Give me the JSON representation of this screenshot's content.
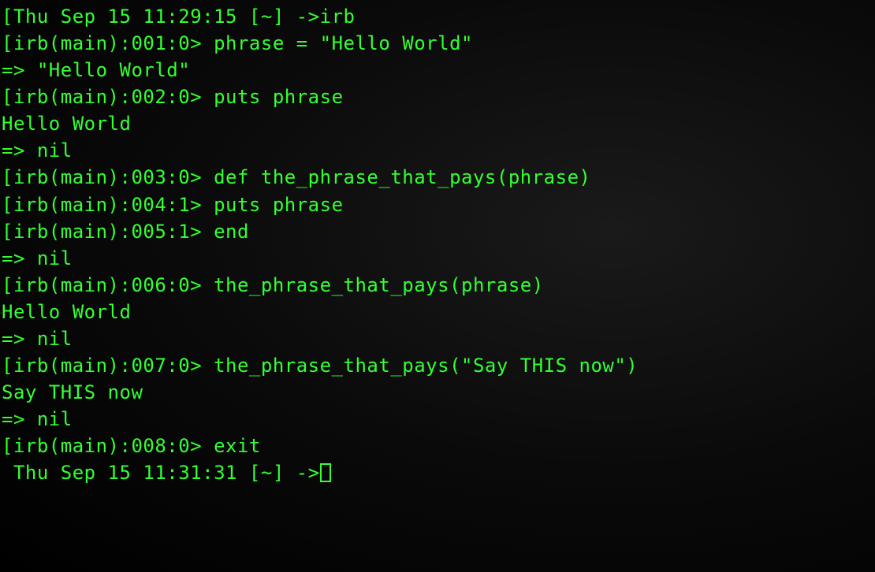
{
  "terminal": {
    "lines": [
      "[Thu Sep 15 11:29:15 [~] ->irb",
      "[irb(main):001:0> phrase = \"Hello World\"",
      "=> \"Hello World\"",
      "[irb(main):002:0> puts phrase",
      "Hello World",
      "=> nil",
      "[irb(main):003:0> def the_phrase_that_pays(phrase)",
      "[irb(main):004:1> puts phrase",
      "[irb(main):005:1> end",
      "=> nil",
      "[irb(main):006:0> the_phrase_that_pays(phrase)",
      "Hello World",
      "=> nil",
      "[irb(main):007:0> the_phrase_that_pays(\"Say THIS now\")",
      "Say THIS now",
      "=> nil",
      "[irb(main):008:0> exit",
      " Thu Sep 15 11:31:31 [~] ->"
    ]
  }
}
